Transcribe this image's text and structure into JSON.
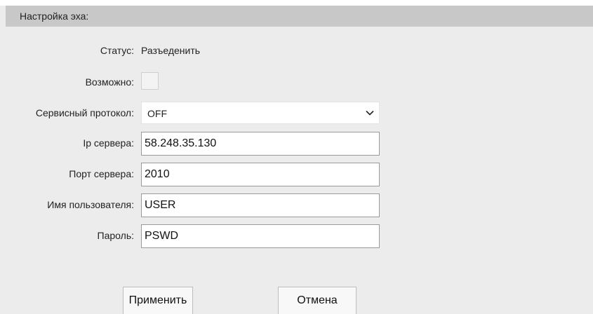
{
  "section": {
    "title": "Настройка эха:"
  },
  "status": {
    "label": "Статус:",
    "value": "Разъеденить"
  },
  "enable": {
    "label": "Возможно:",
    "checked": false
  },
  "service_protocol": {
    "label": "Сервисный протокол:",
    "selected": "OFF"
  },
  "server_ip": {
    "label": "Ip сервера:",
    "value": "58.248.35.130"
  },
  "server_port": {
    "label": "Порт сервера:",
    "value": "2010"
  },
  "username": {
    "label": "Имя пользователя:",
    "value": "USER"
  },
  "password": {
    "label": "Пароль:",
    "value": "PSWD"
  },
  "buttons": {
    "apply": "Применить",
    "cancel": "Отмена"
  }
}
